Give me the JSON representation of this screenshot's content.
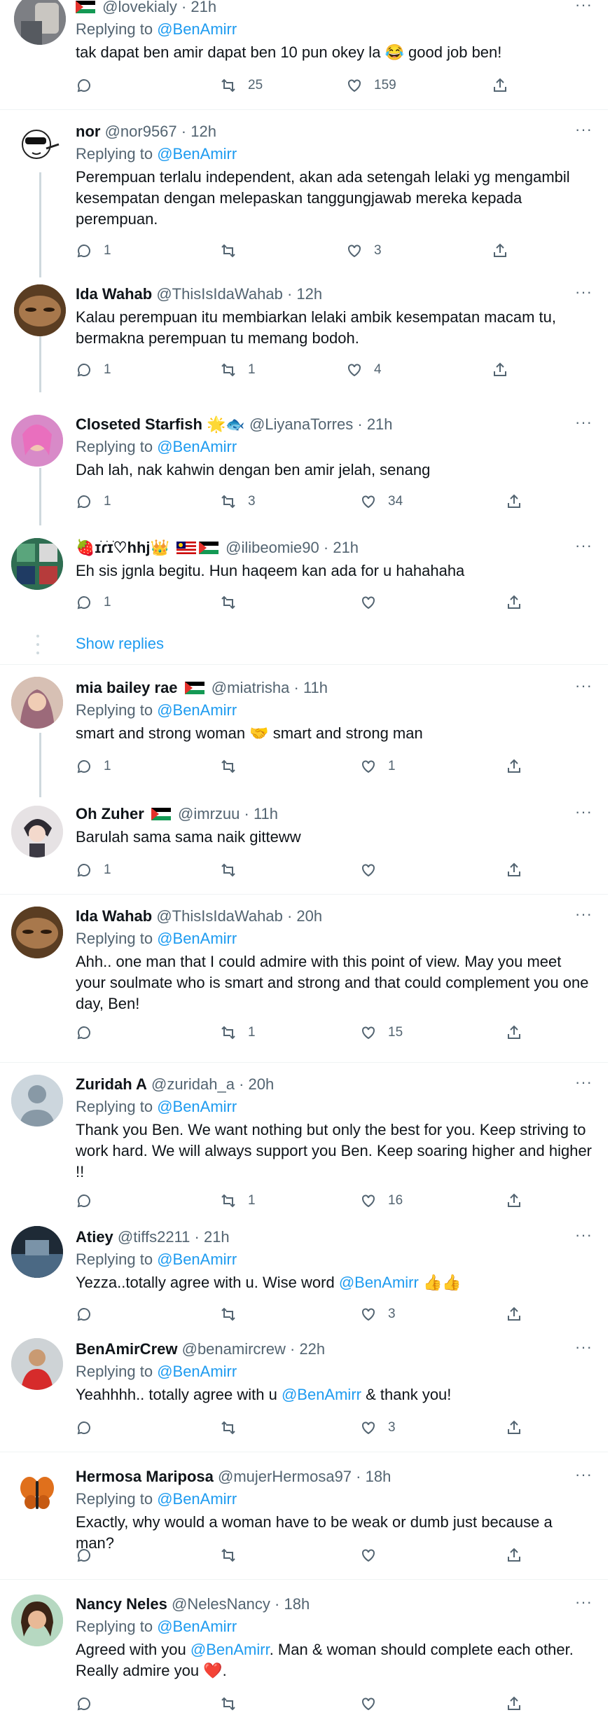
{
  "tweets": [
    {
      "name": "",
      "handle": "@lovekialy",
      "time": "· 21h",
      "reply_to": "@BenAmirr",
      "text": "tak dapat ben amir dapat ben 10 pun okey la 😂 good job ben!",
      "replies": "",
      "retweets": "25",
      "likes": "159"
    },
    {
      "name": "nor",
      "handle": "@nor9567",
      "time": "· 12h",
      "reply_to": "@BenAmirr",
      "text": "Perempuan terlalu independent, akan ada setengah lelaki yg mengambil kesempatan dengan melepaskan tanggungjawab mereka kepada perempuan.",
      "replies": "1",
      "retweets": "",
      "likes": "3"
    },
    {
      "name": "Ida Wahab",
      "handle": "@ThisIsIdaWahab",
      "time": "· 12h",
      "reply_to": "",
      "text": "Kalau perempuan itu membiarkan lelaki ambik kesempatan macam tu, bermakna perempuan tu memang bodoh.",
      "replies": "1",
      "retweets": "1",
      "likes": "4"
    },
    {
      "name": "Closeted Starfish 🌟🐟",
      "handle": "@LiyanaTorres",
      "time": "· 21h",
      "reply_to": "@BenAmirr",
      "text": "Dah lah, nak kahwin dengan ben amir jelah, senang",
      "replies": "1",
      "retweets": "3",
      "likes": "34"
    },
    {
      "name": "🍓ɪׁɾׁɪׁ♡hhj👑",
      "handle": "@ilibeomie90",
      "time": "· 21h",
      "reply_to": "",
      "text": "Eh sis jgnla begitu. Hun haqeem kan ada for u hahahaha",
      "replies": "1",
      "retweets": "",
      "likes": ""
    },
    {
      "name": "mia bailey rae",
      "handle": "@miatrisha",
      "time": "· 11h",
      "reply_to": "@BenAmirr",
      "text": "smart and strong woman 🤝 smart and strong man",
      "replies": "1",
      "retweets": "",
      "likes": "1"
    },
    {
      "name": "Oh Zuher",
      "handle": "@imrzuu",
      "time": "· 11h",
      "reply_to": "",
      "text": "Barulah sama sama naik gitteww",
      "replies": "1",
      "retweets": "",
      "likes": ""
    },
    {
      "name": "Ida Wahab",
      "handle": "@ThisIsIdaWahab",
      "time": "· 20h",
      "reply_to": "@BenAmirr",
      "text": "Ahh.. one man that I could admire with this point of view. May you meet your soulmate who is smart and strong and that could complement you one day, Ben!",
      "replies": "",
      "retweets": "1",
      "likes": "15"
    },
    {
      "name": "Zuridah A",
      "handle": "@zuridah_a",
      "time": "· 20h",
      "reply_to": "@BenAmirr",
      "text": "Thank you Ben. We want nothing but only the best for you. Keep striving to work hard. We will always support you Ben. Keep soaring higher and higher !!",
      "replies": "",
      "retweets": "1",
      "likes": "16"
    },
    {
      "name": "Atiey",
      "handle": "@tiffs2211",
      "time": "· 21h",
      "reply_to": "@BenAmirr",
      "text_a": "Yezza..totally agree with u. Wise word ",
      "text_mention": "@BenAmirr",
      "text_b": " 👍👍",
      "replies": "",
      "retweets": "",
      "likes": "3"
    },
    {
      "name": "BenAmirCrew",
      "handle": "@benamircrew",
      "time": "· 22h",
      "reply_to": "@BenAmirr",
      "text_a": "Yeahhhh.. totally agree with u ",
      "text_mention": "@BenAmirr",
      "text_b": " & thank you!",
      "replies": "",
      "retweets": "",
      "likes": "3"
    },
    {
      "name": "Hermosa Mariposa",
      "handle": "@mujerHermosa97",
      "time": "· 18h",
      "reply_to": "@BenAmirr",
      "text": "Exactly, why would a woman have to be weak or dumb just because a man?",
      "replies": "",
      "retweets": "",
      "likes": ""
    },
    {
      "name": "Nancy Neles",
      "handle": "@NelesNancy",
      "time": "· 18h",
      "reply_to": "@BenAmirr",
      "text_a": "Agreed with you ",
      "text_mention": "@BenAmirr",
      "text_b": ". Man & woman should complete each other. Really admire you ❤️.",
      "replies": "",
      "retweets": "",
      "likes": ""
    }
  ],
  "labels": {
    "replying_to": "Replying to ",
    "show_replies": "Show replies",
    "more": "···"
  },
  "icons": [
    "reply-icon",
    "retweet-icon",
    "like-icon",
    "share-icon",
    "more-icon",
    "flag-palestine-icon",
    "flag-malaysia-icon"
  ],
  "colors": {
    "link": "#1d9bf0",
    "muted": "#536471",
    "text": "#0f1419",
    "line": "#cfd9de",
    "heart": "#e0245e"
  }
}
